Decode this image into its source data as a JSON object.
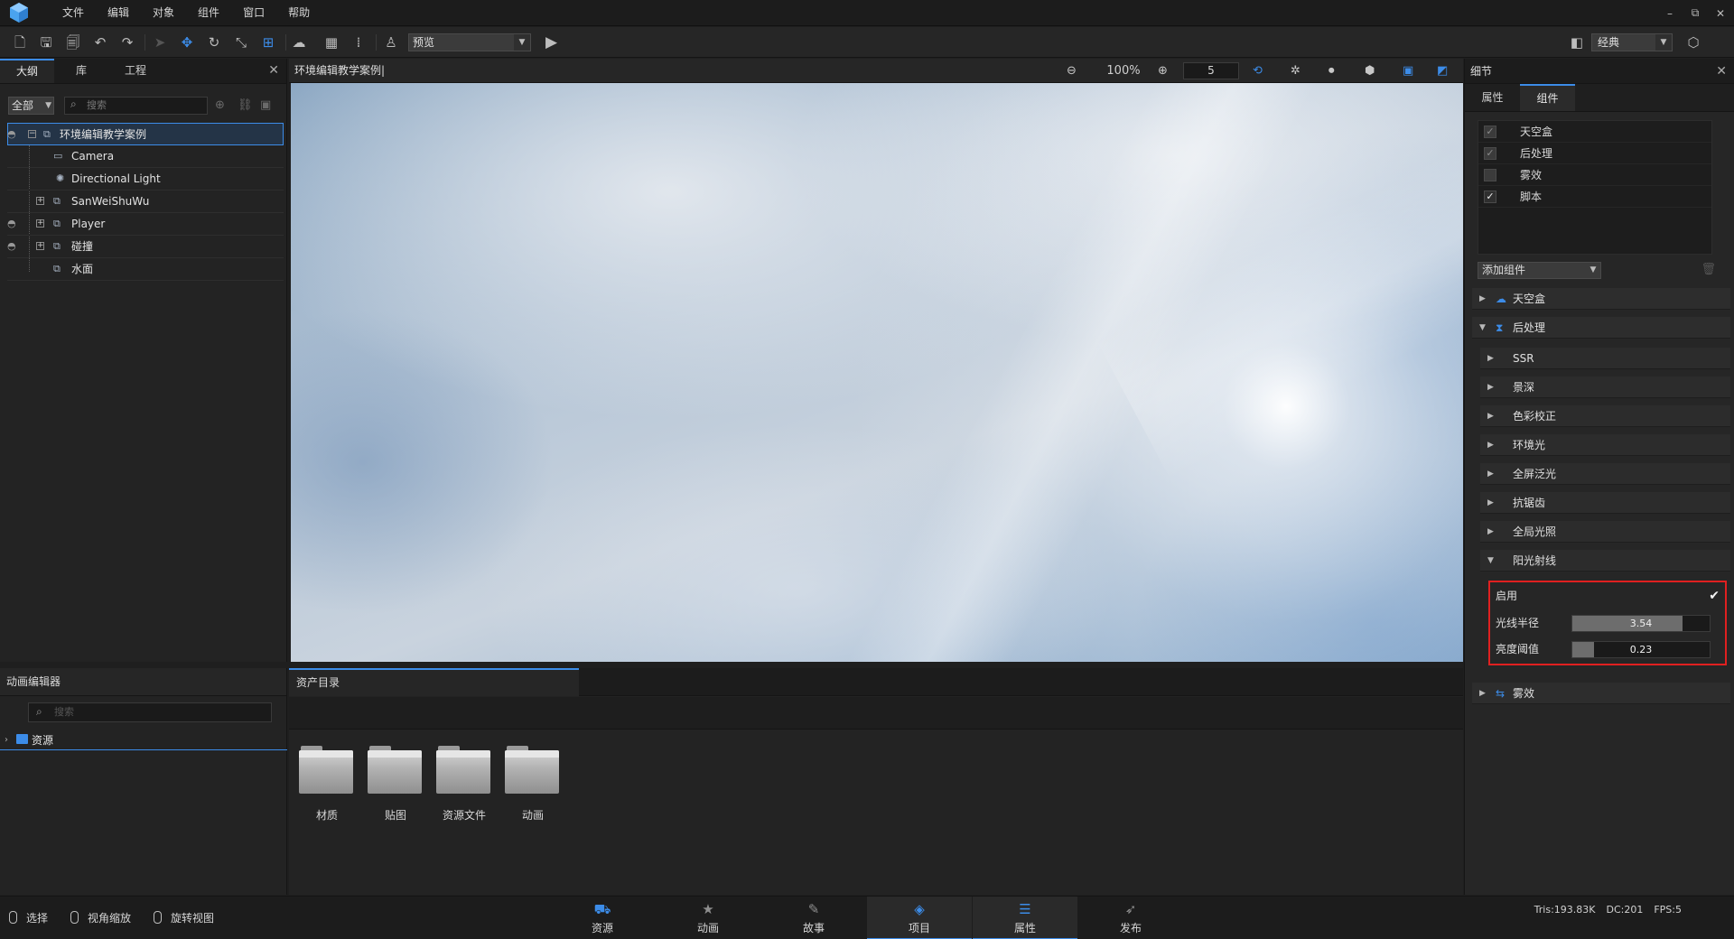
{
  "menubar": {
    "items": [
      "文件",
      "编辑",
      "对象",
      "组件",
      "窗口",
      "帮助"
    ],
    "window_controls": [
      "–",
      "⧉",
      "✕"
    ]
  },
  "toolbar": {
    "preview_mode": "预览",
    "layout_mode": "经典"
  },
  "outline": {
    "tabs": [
      "大纲",
      "库",
      "工程"
    ],
    "filter": "全部",
    "search_placeholder": "搜索",
    "tree": [
      {
        "label": "环境编辑教学案例",
        "icon": "group-icon",
        "expandable": true,
        "selected": true,
        "eye": true
      },
      {
        "label": "Camera",
        "icon": "camera-icon",
        "expandable": false,
        "selected": false,
        "eye": false
      },
      {
        "label": "Directional Light",
        "icon": "light-icon",
        "expandable": false,
        "selected": false,
        "eye": false
      },
      {
        "label": "SanWeiShuWu",
        "icon": "group-icon",
        "expandable": true,
        "selected": false,
        "eye": false
      },
      {
        "label": "Player",
        "icon": "group-icon",
        "expandable": true,
        "selected": false,
        "eye": true
      },
      {
        "label": "碰撞",
        "icon": "group-icon",
        "expandable": true,
        "selected": false,
        "eye": true
      },
      {
        "label": "水面",
        "icon": "group-icon",
        "expandable": false,
        "selected": false,
        "eye": false
      }
    ]
  },
  "viewport": {
    "title": "环境编辑教学案例|",
    "zoom": "100%",
    "speed": "5"
  },
  "details": {
    "title": "细节",
    "tabs": [
      "属性",
      "组件"
    ],
    "components": [
      {
        "label": "天空盒",
        "checked": true
      },
      {
        "label": "后处理",
        "checked": true
      },
      {
        "label": "雾效",
        "checked": false
      },
      {
        "label": "脚本",
        "checked": true
      }
    ],
    "add_component": "添加组件",
    "sections": {
      "skybox": "天空盒",
      "postprocess": "后处理",
      "sub": [
        "SSR",
        "景深",
        "色彩校正",
        "环境光",
        "全屏泛光",
        "抗锯齿",
        "全局光照",
        "阳光射线"
      ],
      "fog": "雾效"
    },
    "sunray": {
      "enable_label": "启用",
      "enabled": true,
      "radius_label": "光线半径",
      "radius_value": "3.54",
      "radius_fill": 0.8,
      "threshold_label": "亮度阈值",
      "threshold_value": "0.23",
      "threshold_fill": 0.16
    }
  },
  "anim_editor": {
    "title": "动画编辑器",
    "search_placeholder": "搜索",
    "root": "资源"
  },
  "assets": {
    "tab": "资产目录",
    "folders": [
      "材质",
      "贴图",
      "资源文件",
      "动画"
    ]
  },
  "statusbar": {
    "hints": [
      "选择",
      "视角缩放",
      "旋转视图"
    ],
    "tabs": [
      {
        "label": "资源",
        "icon": "⛟"
      },
      {
        "label": "动画",
        "icon": "★"
      },
      {
        "label": "故事",
        "icon": "✎"
      },
      {
        "label": "项目",
        "icon": "◈"
      },
      {
        "label": "属性",
        "icon": "☰"
      },
      {
        "label": "发布",
        "icon": "➶"
      }
    ],
    "active_tabs": [
      "项目",
      "属性"
    ],
    "tris": "Tris:193.83K",
    "dc": "DC:201",
    "fps": "FPS:5"
  },
  "colors": {
    "accent": "#3c8ce8",
    "highlight_box": "#e02020"
  }
}
